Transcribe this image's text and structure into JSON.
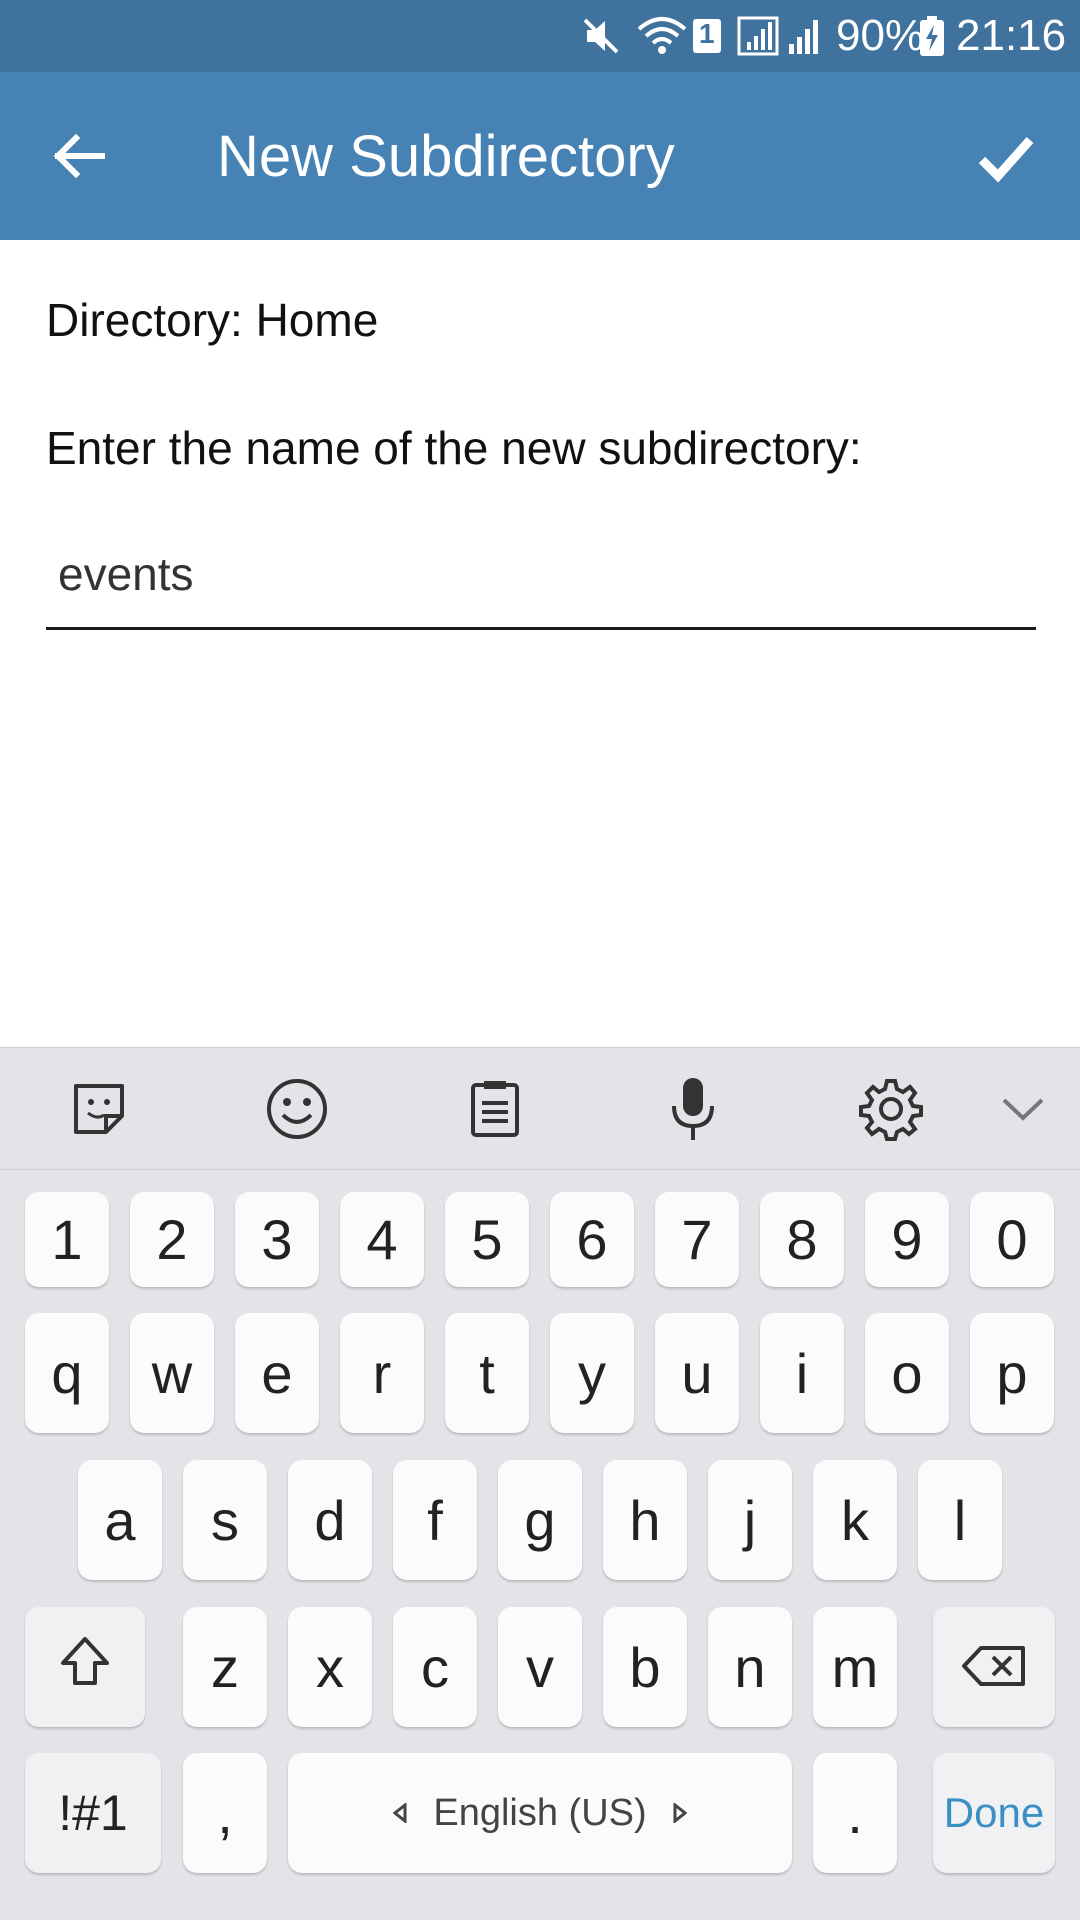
{
  "status_bar": {
    "battery": "90%",
    "time": "21:16",
    "sim_badge": "1",
    "icons": [
      "mute-icon",
      "wifi-icon",
      "sim-icon",
      "signal-icon",
      "signal-icon",
      "battery-charging-icon"
    ]
  },
  "app_bar": {
    "title": "New Subdirectory",
    "back_icon": "back-arrow-icon",
    "confirm_icon": "check-icon",
    "color": "#4682b4"
  },
  "content": {
    "directory_line": "Directory: Home",
    "prompt": "Enter the name of the new subdirectory:",
    "name_input_value": "events"
  },
  "keyboard": {
    "toolbar_icons": [
      "sticker-icon",
      "emoji-icon",
      "clipboard-icon",
      "microphone-icon",
      "settings-icon",
      "collapse-chevron-icon"
    ],
    "row_numbers": [
      "1",
      "2",
      "3",
      "4",
      "5",
      "6",
      "7",
      "8",
      "9",
      "0"
    ],
    "row_top": [
      "q",
      "w",
      "e",
      "r",
      "t",
      "y",
      "u",
      "i",
      "o",
      "p"
    ],
    "row_middle": [
      "a",
      "s",
      "d",
      "f",
      "g",
      "h",
      "j",
      "k",
      "l"
    ],
    "row_bottom": [
      "z",
      "x",
      "c",
      "v",
      "b",
      "n",
      "m"
    ],
    "symbols_key": "!#1",
    "comma_key": ",",
    "space_label": "English (US)",
    "period_key": ".",
    "done_key": "Done",
    "accent": "#3b8fc4"
  }
}
